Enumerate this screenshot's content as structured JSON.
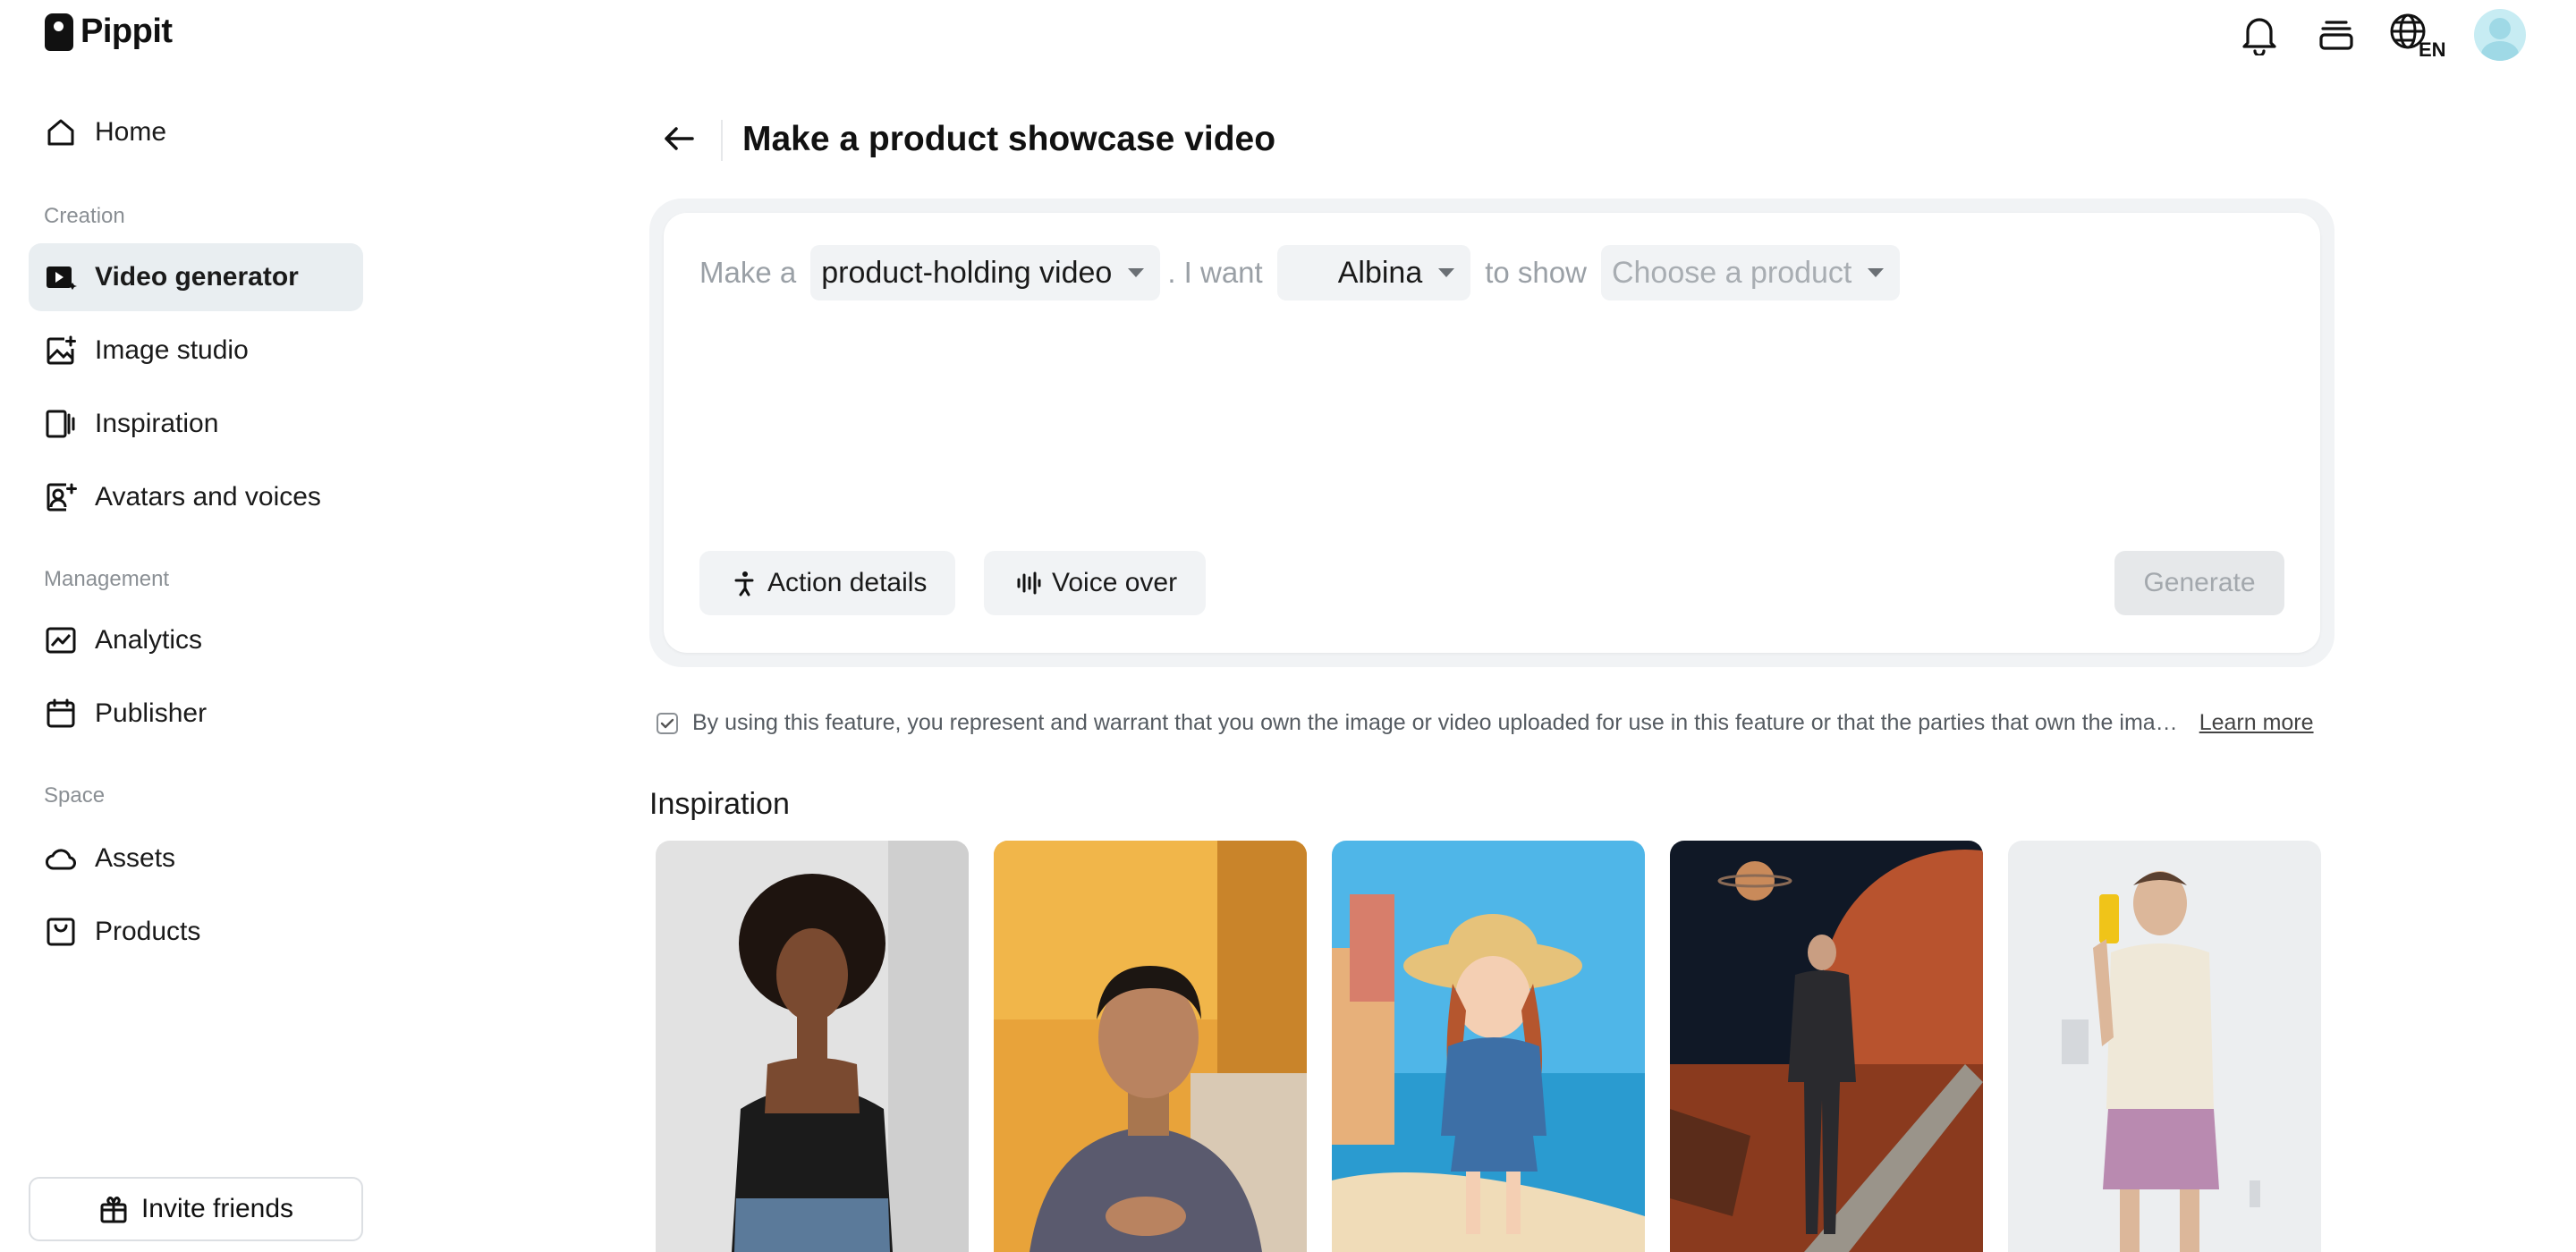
{
  "app": {
    "name": "Pippit"
  },
  "topbar": {
    "language_label": "EN"
  },
  "sidebar": {
    "home": "Home",
    "sections": {
      "creation": "Creation",
      "management": "Management",
      "space": "Space"
    },
    "items": {
      "video_generator": "Video generator",
      "image_studio": "Image studio",
      "inspiration": "Inspiration",
      "avatars_voices": "Avatars and voices",
      "analytics": "Analytics",
      "publisher": "Publisher",
      "assets": "Assets",
      "products": "Products"
    },
    "active_item": "Video generator",
    "invite_label": "Invite friends"
  },
  "main": {
    "title": "Make a product showcase video",
    "prompt": {
      "prefix": "Make a",
      "video_type": "product-holding video",
      "middle": ". I want",
      "avatar": "Albina",
      "suffix": "to show",
      "product_placeholder": "Choose a product"
    },
    "actions": {
      "action_details": "Action details",
      "voice_over": "Voice over",
      "generate": "Generate"
    },
    "consent": {
      "checked": true,
      "text": "By using this feature, you represent and warrant that you own the image or video uploaded for use in this feature or that the parties that own the ima…",
      "learn_more": "Learn more"
    },
    "inspiration": {
      "title": "Inspiration"
    }
  },
  "colors": {
    "active_nav_bg": "#e9eef1",
    "card_bg": "#f1f3f5",
    "generate_disabled_bg": "#e6e8ea"
  }
}
